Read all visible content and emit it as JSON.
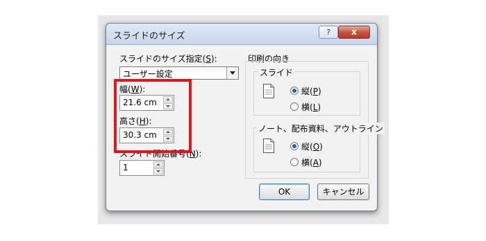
{
  "dialog": {
    "title": "スライドのサイズ",
    "help_label": "?",
    "close_label": "x"
  },
  "slide_size": {
    "label": "スライドのサイズ指定(",
    "accel": "S",
    "label_end": "):",
    "value": "ユーザー設定"
  },
  "width": {
    "label": "幅(",
    "accel": "W",
    "label_end": "):",
    "value": "21.6 cm"
  },
  "height": {
    "label": "高さ(",
    "accel": "H",
    "label_end": "):",
    "value": "30.3 cm"
  },
  "start_number": {
    "label": "スライド開始番号(",
    "accel": "N",
    "label_end": "):",
    "value": "1"
  },
  "orientation": {
    "title": "印刷の向き",
    "slides": {
      "title": "スライド",
      "portrait": {
        "label": "縦(",
        "accel": "P",
        "label_end": ")",
        "checked": true
      },
      "landscape": {
        "label": "横(",
        "accel": "L",
        "label_end": ")",
        "checked": false
      }
    },
    "notes": {
      "title": "ノート、配布資料、アウトライン",
      "portrait": {
        "label": "縦(",
        "accel": "O",
        "label_end": ")",
        "checked": true
      },
      "landscape": {
        "label": "横(",
        "accel": "A",
        "label_end": ")",
        "checked": false
      }
    }
  },
  "buttons": {
    "ok": "OK",
    "cancel": "キャンセル"
  },
  "colors": {
    "highlight": "#e0161c",
    "titlebar": "#c6d6ea",
    "close": "#c4503c"
  },
  "icons": [
    "help-icon",
    "close-icon",
    "document-portrait-icon",
    "dropdown-arrow-icon",
    "spin-up-icon",
    "spin-down-icon"
  ]
}
